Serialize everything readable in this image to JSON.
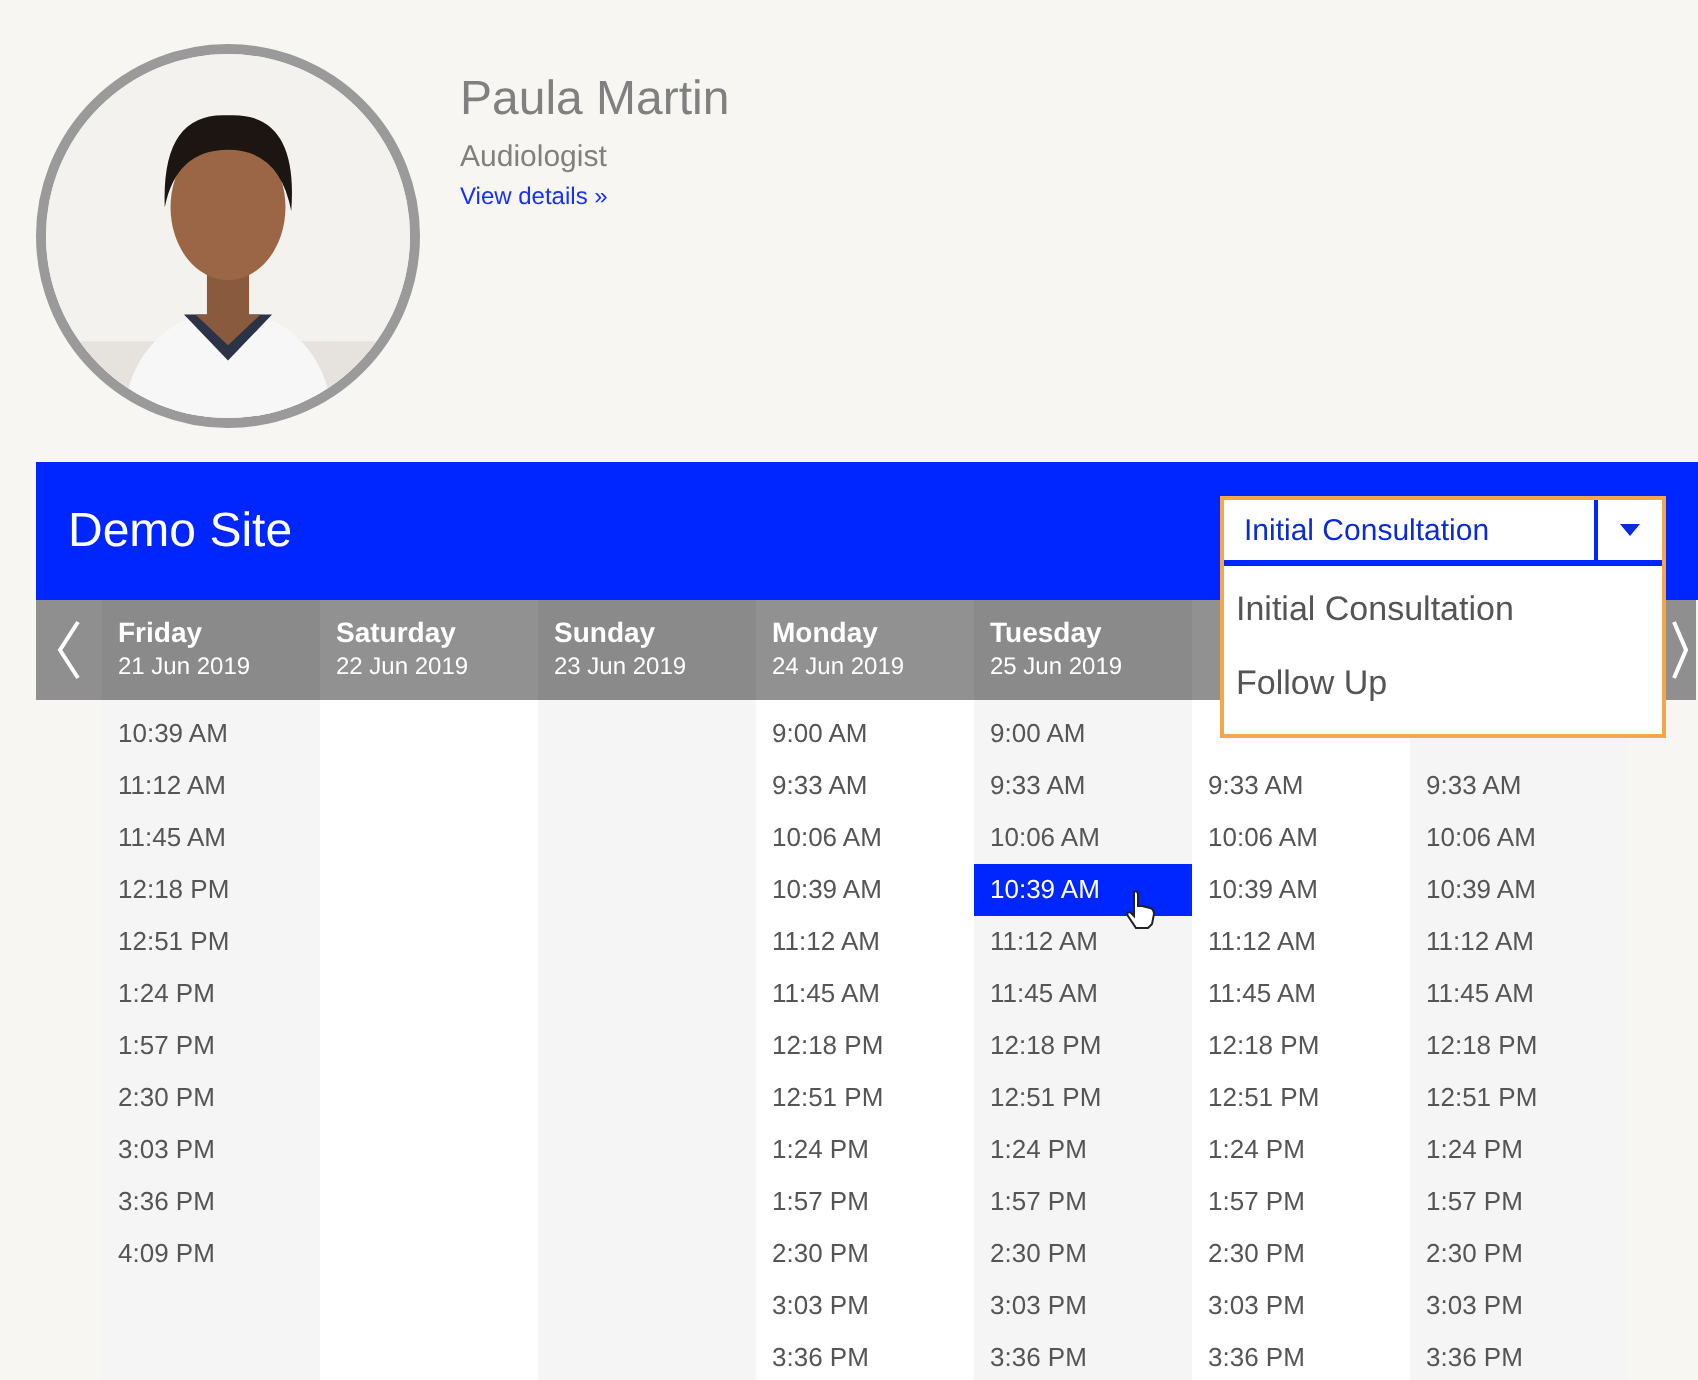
{
  "profile": {
    "name": "Paula Martin",
    "role": "Audiologist",
    "link": "View details »"
  },
  "site": {
    "title": "Demo Site"
  },
  "service_select": {
    "value": "Initial Consultation",
    "options": [
      "Initial Consultation",
      "Follow Up"
    ]
  },
  "days": [
    {
      "day": "Friday",
      "date": "21 Jun 2019",
      "times": [
        {
          "label": "10:39 AM",
          "selected": false
        },
        {
          "label": "11:12 AM",
          "selected": false
        },
        {
          "label": "11:45 AM",
          "selected": false
        },
        {
          "label": "12:18 PM",
          "selected": false
        },
        {
          "label": "12:51 PM",
          "selected": false
        },
        {
          "label": "1:24 PM",
          "selected": false
        },
        {
          "label": "1:57 PM",
          "selected": false
        },
        {
          "label": "2:30 PM",
          "selected": false
        },
        {
          "label": "3:03 PM",
          "selected": false
        },
        {
          "label": "3:36 PM",
          "selected": false
        },
        {
          "label": "4:09 PM",
          "selected": false
        }
      ]
    },
    {
      "day": "Saturday",
      "date": "22 Jun 2019"
    },
    {
      "day": "Sunday",
      "date": "23 Jun 2019"
    },
    {
      "day": "Monday",
      "date": "24 Jun 2019",
      "times": [
        {
          "label": "9:00 AM",
          "selected": false
        },
        {
          "label": "9:33 AM",
          "selected": false
        },
        {
          "label": "10:06 AM",
          "selected": false
        },
        {
          "label": "10:39 AM",
          "selected": false
        },
        {
          "label": "11:12 AM",
          "selected": false
        },
        {
          "label": "11:45 AM",
          "selected": false
        },
        {
          "label": "12:18 PM",
          "selected": false
        },
        {
          "label": "12:51 PM",
          "selected": false
        },
        {
          "label": "1:24 PM",
          "selected": false
        },
        {
          "label": "1:57 PM",
          "selected": false
        },
        {
          "label": "2:30 PM",
          "selected": false
        },
        {
          "label": "3:03 PM",
          "selected": false
        },
        {
          "label": "3:36 PM",
          "selected": false
        }
      ]
    },
    {
      "day": "Tuesday",
      "date": "25 Jun 2019",
      "times": [
        {
          "label": "9:00 AM",
          "selected": false
        },
        {
          "label": "9:33 AM",
          "selected": false
        },
        {
          "label": "10:06 AM",
          "selected": false
        },
        {
          "label": "10:39 AM",
          "selected": true
        },
        {
          "label": "11:12 AM",
          "selected": false
        },
        {
          "label": "11:45 AM",
          "selected": false
        },
        {
          "label": "12:18 PM",
          "selected": false
        },
        {
          "label": "12:51 PM",
          "selected": false
        },
        {
          "label": "1:24 PM",
          "selected": false
        },
        {
          "label": "1:57 PM",
          "selected": false
        },
        {
          "label": "2:30 PM",
          "selected": false
        },
        {
          "label": "3:03 PM",
          "selected": false
        },
        {
          "label": "3:36 PM",
          "selected": false
        }
      ]
    },
    {
      "times": [
        {
          "label": "9:33 AM",
          "selected": false
        },
        {
          "label": "10:06 AM",
          "selected": false
        },
        {
          "label": "10:39 AM",
          "selected": false
        },
        {
          "label": "11:12 AM",
          "selected": false
        },
        {
          "label": "11:45 AM",
          "selected": false
        },
        {
          "label": "12:18 PM",
          "selected": false
        },
        {
          "label": "12:51 PM",
          "selected": false
        },
        {
          "label": "1:24 PM",
          "selected": false
        },
        {
          "label": "1:57 PM",
          "selected": false
        },
        {
          "label": "2:30 PM",
          "selected": false
        },
        {
          "label": "3:03 PM",
          "selected": false
        },
        {
          "label": "3:36 PM",
          "selected": false
        }
      ]
    },
    {
      "times": [
        {
          "label": "9:33 AM",
          "selected": false
        },
        {
          "label": "10:06 AM",
          "selected": false
        },
        {
          "label": "10:39 AM",
          "selected": false
        },
        {
          "label": "11:12 AM",
          "selected": false
        },
        {
          "label": "11:45 AM",
          "selected": false
        },
        {
          "label": "12:18 PM",
          "selected": false
        },
        {
          "label": "12:51 PM",
          "selected": false
        },
        {
          "label": "1:24 PM",
          "selected": false
        },
        {
          "label": "1:57 PM",
          "selected": false
        },
        {
          "label": "2:30 PM",
          "selected": false
        },
        {
          "label": "3:03 PM",
          "selected": false
        },
        {
          "label": "3:36 PM",
          "selected": false
        }
      ]
    }
  ]
}
